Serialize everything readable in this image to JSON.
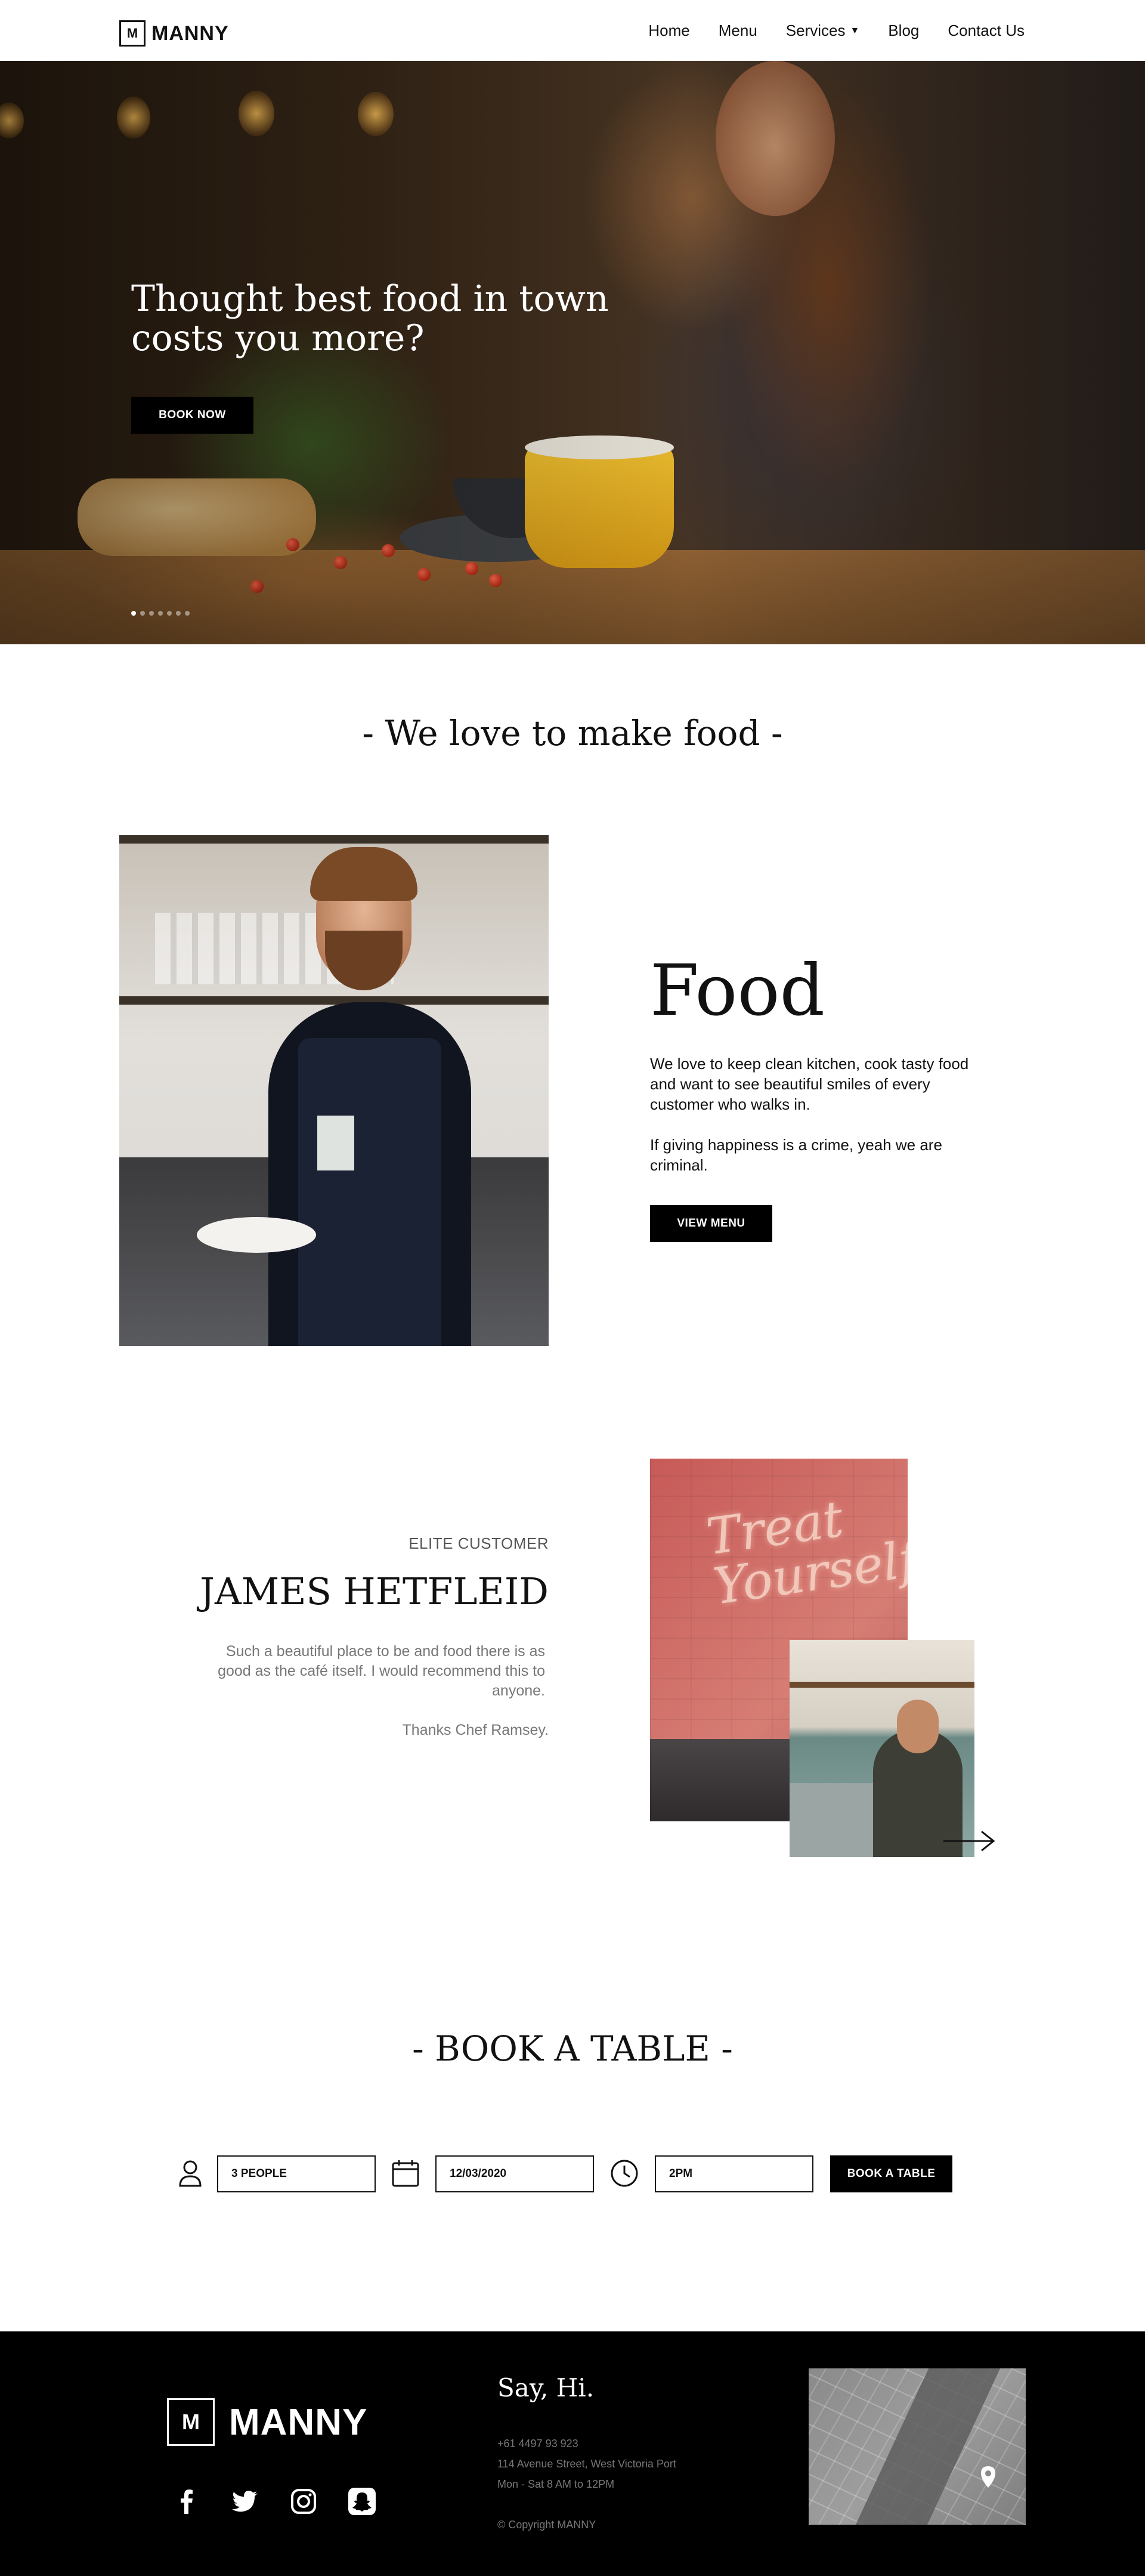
{
  "nav": {
    "logo_mark": "M",
    "logo_text": "MANNY",
    "links": [
      {
        "label": "Home"
      },
      {
        "label": "Menu"
      },
      {
        "label": "Services",
        "has_dropdown": true
      },
      {
        "label": "Blog"
      },
      {
        "label": "Contact Us"
      }
    ]
  },
  "hero": {
    "title": "Thought best food in town costs you more?",
    "button_label": "BOOK NOW",
    "slides_total": 7,
    "active_slide": 1
  },
  "love": {
    "title": "- We love to make food -"
  },
  "food": {
    "title": "Food",
    "paragraph1": "We love to keep clean kitchen, cook tasty food and want to see beautiful smiles of every customer who walks in.",
    "paragraph2": "If giving happiness is a crime, yeah we are criminal.",
    "button_label": "VIEW MENU"
  },
  "testimonial": {
    "label": "ELITE CUSTOMER",
    "name": "JAMES HETFLEID",
    "quote": "Such a beautiful place to be and food there is as good as the café itself. I would recommend this to anyone.",
    "thanks": "Thanks Chef Ramsey.",
    "neon_sign": "Treat Yourself"
  },
  "booking": {
    "title": "- BOOK A TABLE -",
    "people_value": "3 PEOPLE",
    "date_value": "12/03/2020",
    "time_value": "2PM",
    "button_label": "BOOK A TABLE",
    "icons": [
      "person-icon",
      "calendar-icon",
      "clock-icon"
    ]
  },
  "footer": {
    "logo_mark": "M",
    "logo_text": "MANNY",
    "say_hi": "Say, Hi.",
    "phone": "+61 4497 93 923",
    "address": "114 Avenue Street, West Victoria Port",
    "hours": "Mon - Sat 8 AM to 12PM",
    "copyright": "© Copyright MANNY",
    "socials": [
      "facebook-icon",
      "twitter-icon",
      "instagram-icon",
      "snapchat-icon"
    ]
  },
  "colors": {
    "black": "#000000",
    "white": "#ffffff",
    "muted_text": "#777777",
    "accent_yellow": "#f3c331"
  }
}
